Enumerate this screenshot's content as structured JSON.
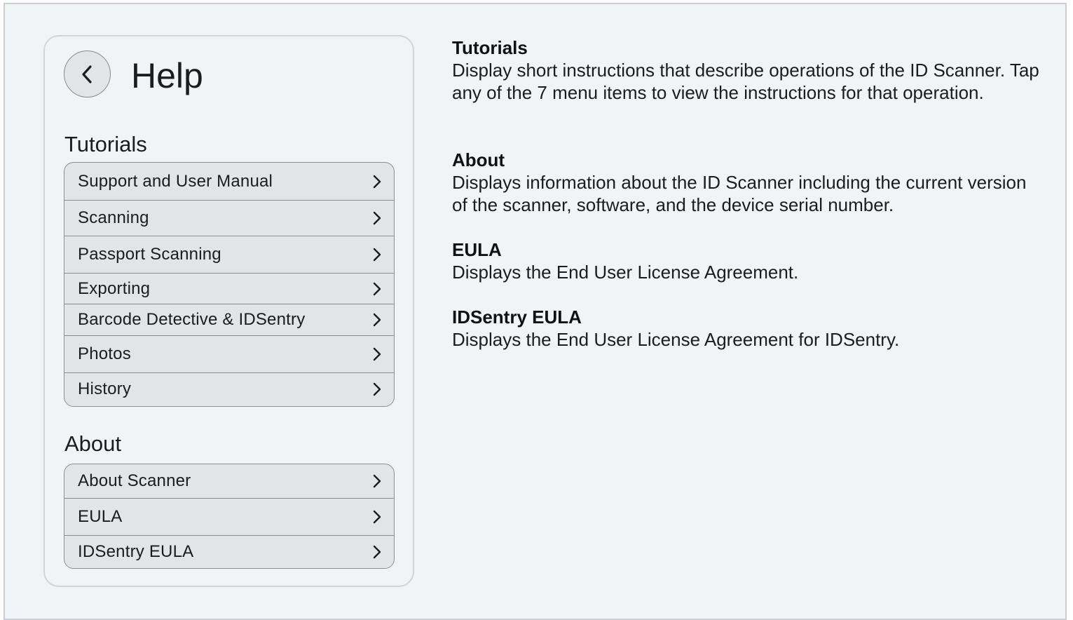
{
  "page": {
    "title": "Help"
  },
  "sections": {
    "tutorials": {
      "heading": "Tutorials",
      "items": [
        {
          "label": "Support and User Manual"
        },
        {
          "label": "Scanning"
        },
        {
          "label": "Passport Scanning"
        },
        {
          "label": "Exporting"
        },
        {
          "label": "Barcode Detective & IDSentry"
        },
        {
          "label": "Photos"
        },
        {
          "label": "History"
        }
      ]
    },
    "about": {
      "heading": "About",
      "items": [
        {
          "label": "About Scanner"
        },
        {
          "label": "EULA"
        },
        {
          "label": "IDSentry EULA"
        }
      ]
    }
  },
  "descriptions": [
    {
      "title": "Tutorials",
      "body": "Display short instructions that describe operations of the ID Scanner. Tap any of the 7 menu items to view the instructions for that operation."
    },
    {
      "title": "About",
      "body": "Displays information about the ID Scanner including the current version of the scanner, software, and the device serial number."
    },
    {
      "title": "EULA",
      "body": "Displays the End User License Agreement."
    },
    {
      "title": "IDSentry EULA",
      "body": "Displays the End User License Agreement for IDSentry."
    }
  ],
  "icons": {
    "back": "chevron-left-icon",
    "row": "chevron-right-icon"
  },
  "colors": {
    "background": "#f0f4f7",
    "row_fill": "#e3e4e7",
    "border": "#8d8e93"
  }
}
